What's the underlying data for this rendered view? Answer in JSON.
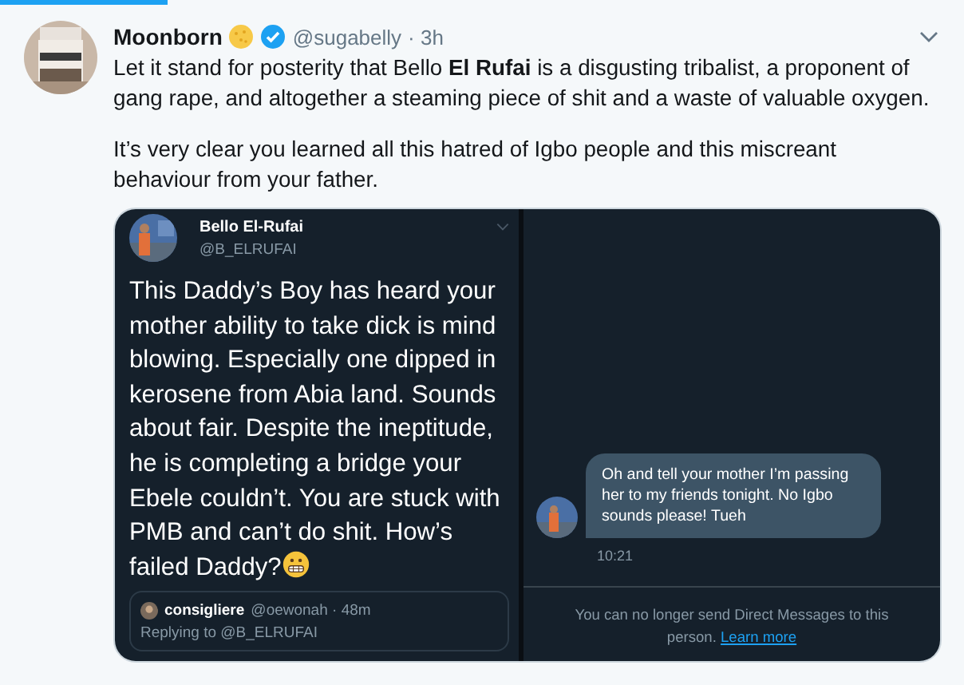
{
  "tweet": {
    "author": "Moonborn",
    "handle": "@sugabelly",
    "time": "· 3h",
    "verified": true,
    "paragraphs": [
      "Let it stand for posterity that Bello **El Rufai** is a disgusting tribalist, a proponent of gang rape, and altogether a steaming piece of shit and a waste of valuable oxygen.",
      "It’s very clear you learned all this hatred of Igbo people and this miscreant behaviour from your father."
    ]
  },
  "embedded_tweet": {
    "author": "Bello El-Rufai",
    "handle": "@B_ELRUFAI",
    "text": "This Daddy’s Boy has heard your mother ability to take dick is mind blowing. Especially one dipped in kerosene from Abia land. Sounds about fair. Despite the ineptitude, he is completing a bridge your Ebele couldn’t. You are stuck with PMB and can’t do shit. How’s failed Daddy?",
    "quote": {
      "author": "consigliere",
      "handle": "@oewonah · 48m",
      "reply": "Replying to @B_ELRUFAI"
    }
  },
  "direct_message": {
    "message": "Oh and tell your mother I’m passing her to my friends tonight. No Igbo sounds please! Tueh",
    "time": "10:21",
    "notice": "You can no longer send Direct Messages to this person.",
    "link": "Learn more"
  }
}
